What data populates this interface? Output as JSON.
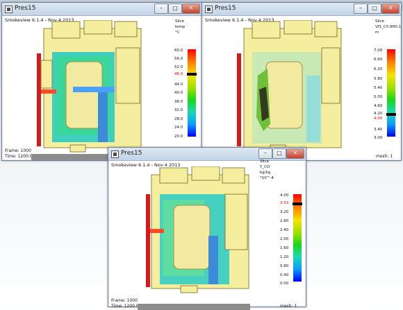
{
  "windows": [
    {
      "title": "Pres15",
      "app_title": "Smokeview 6.1.4 - Nov  4 2013",
      "colorbar": {
        "heading": [
          "Slice",
          "temp",
          "°C"
        ],
        "labels": [
          "60.0",
          "56.0",
          "52.0",
          "48.0",
          "44.0",
          "40.0",
          "36.0",
          "32.0",
          "28.0",
          "24.0",
          "20.0"
        ],
        "highlighted": "48.0"
      },
      "frame": "Frame: 1000",
      "time": "Time: 1200.0"
    },
    {
      "title": "Pres15",
      "app_title": "Smokeview 6.1.4 - Nov  4 2013",
      "colorbar": {
        "heading": [
          "Slice",
          "VIS_C0.9H0.1",
          "m"
        ],
        "labels": [
          "7.00",
          "6.60",
          "6.20",
          "5.80",
          "5.40",
          "5.00",
          "4.60",
          "4.20",
          "4.00",
          "3.40",
          "3.00"
        ],
        "highlighted": "4.00"
      },
      "mesh": "mesh: 1"
    },
    {
      "title": "Pres15",
      "app_title": "Smokeview 6.1.4 - Nov  4 2013",
      "colorbar": {
        "heading": [
          "Slice",
          "Y_CO",
          "kg/kg",
          "*10^-4"
        ],
        "labels": [
          "4.00",
          "3.53",
          "3.20",
          "2.80",
          "2.40",
          "2.00",
          "1.60",
          "1.20",
          "0.80",
          "0.40",
          "0.00"
        ],
        "highlighted": "3.53"
      },
      "frame": "Frame: 1000",
      "time": "Time: 1200.0",
      "mesh": "mesh: 1"
    }
  ],
  "colors": {
    "wall": "#f5ee9e",
    "room": "#f2eaa0",
    "hot": "#d61a1a",
    "cool": "#45d0c0"
  }
}
